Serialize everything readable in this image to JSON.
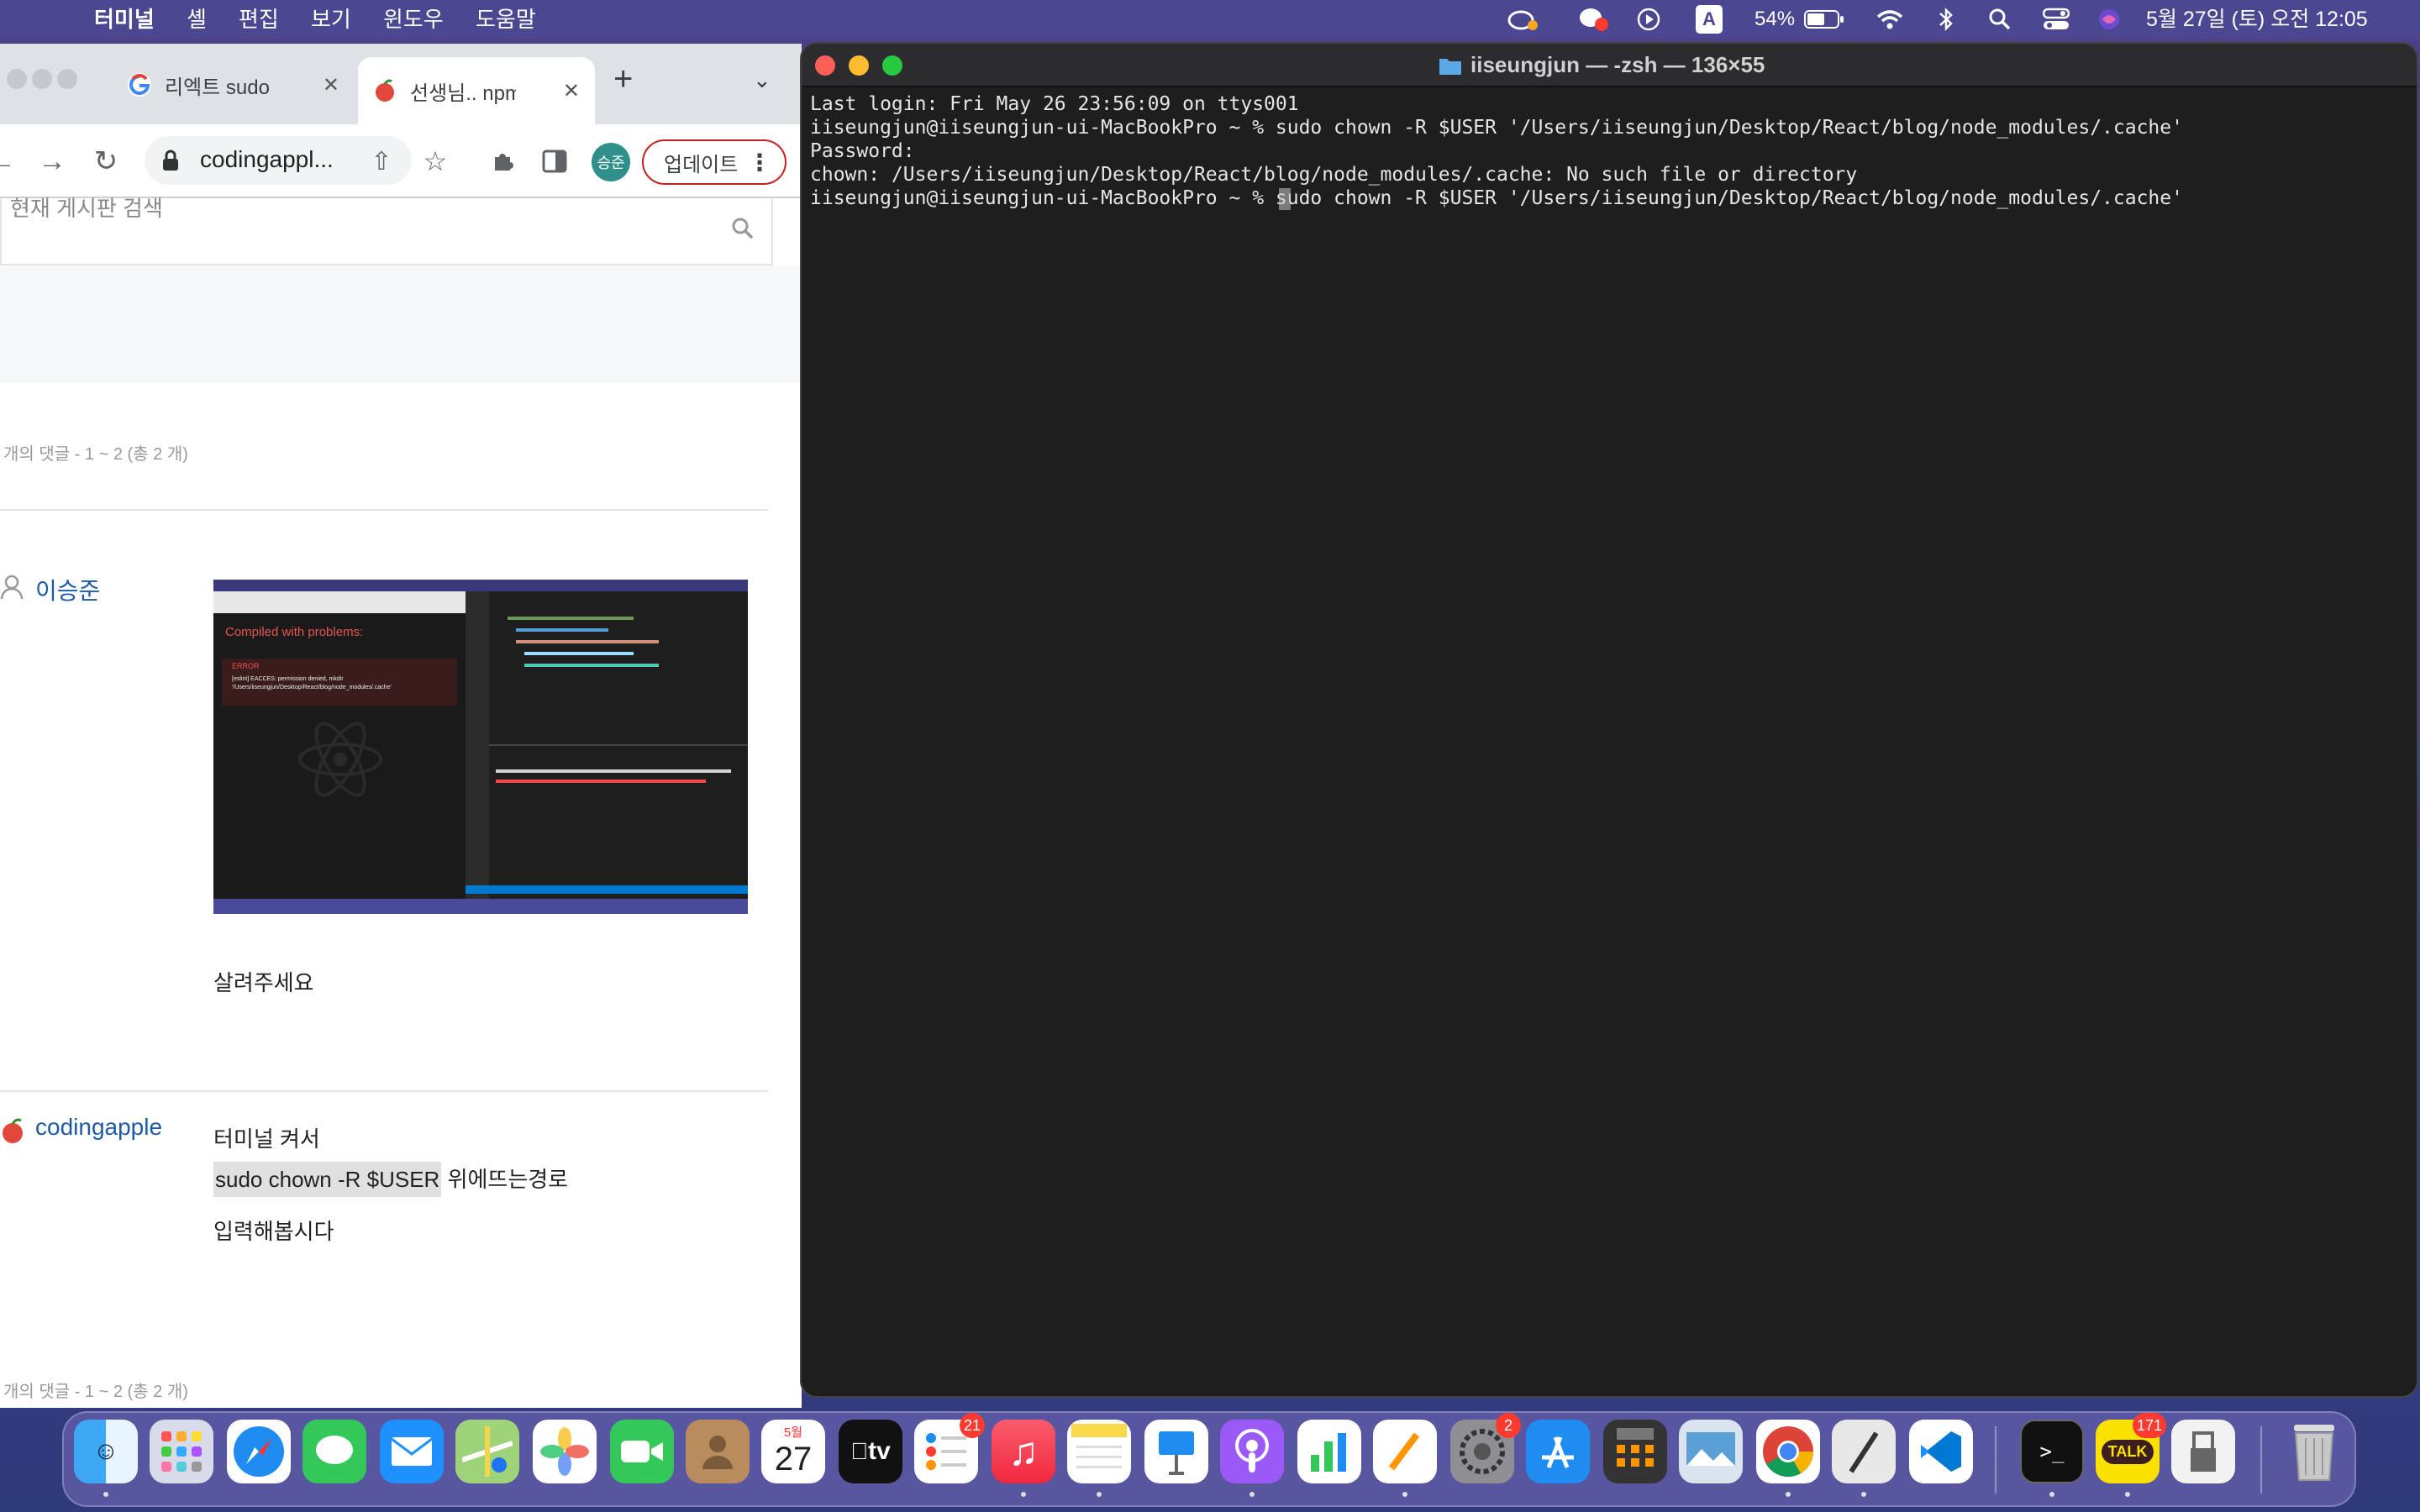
{
  "menubar": {
    "app_name": "터미널",
    "items": [
      "셸",
      "편집",
      "보기",
      "윈도우",
      "도움말"
    ],
    "battery": "54%",
    "input_indicator": "A",
    "clock": "5월 27일 (토) 오전 12:05"
  },
  "browser": {
    "tabs": [
      {
        "title": "리엑트 sudo ch"
      },
      {
        "title": "선생님.. npm s"
      }
    ],
    "address": "codingappl...",
    "profile_initial": "승준",
    "update_label": "업데이트",
    "search_placeholder": "현재 게시판 검색",
    "comment_range_top": "개의 댓글 - 1 ~ 2 (총 2 개)",
    "comment_range_bottom": "개의 댓글 - 1 ~ 2 (총 2 개)",
    "comments": [
      {
        "author": "이승준",
        "body": "살려주세요"
      },
      {
        "author": "codingapple",
        "line1": "터미널 켜서",
        "line2_code": "sudo chown -R $USER",
        "line2_rest": " 위에뜨는경로",
        "line3": "입력해봅시다"
      }
    ],
    "screenshot": {
      "error_title": "Compiled with problems:",
      "error_label": "ERROR",
      "error_text": "[eslint] EACCES: permission denied, mkdir '/Users/iiseungjun/Desktop/React/blog/node_modules/.cache'"
    }
  },
  "terminal": {
    "title": "iiseungjun — -zsh — 136×55",
    "lines": [
      "Last login: Fri May 26 23:56:09 on ttys001",
      "iiseungjun@iiseungjun-ui-MacBookPro ~ % sudo chown -R $USER '/Users/iiseungjun/Desktop/React/blog/node_modules/.cache'",
      "Password:",
      "chown: /Users/iiseungjun/Desktop/React/blog/node_modules/.cache: No such file or directory",
      "iiseungjun@iiseungjun-ui-MacBookPro ~ % sudo chown -R $USER '/Users/iiseungjun/Desktop/React/blog/node_modules/.cache'"
    ]
  },
  "dock": {
    "calendar_month": "5월",
    "calendar_day": "27",
    "tv_label": "tv",
    "badges": {
      "reminders": "21",
      "settings": "2",
      "kakao": "171"
    },
    "kakao_label": "TALK",
    "icons": [
      "finder-icon",
      "launchpad-icon",
      "safari-icon",
      "messages-icon",
      "mail-icon",
      "maps-icon",
      "photos-icon",
      "facetime-icon",
      "contacts-icon",
      "calendar-icon",
      "apple-tv-icon",
      "reminders-icon",
      "music-icon",
      "notes-icon",
      "keynote-icon",
      "podcasts-icon",
      "numbers-icon",
      "pages-icon",
      "system-settings-icon",
      "app-store-icon",
      "calculator-icon",
      "preview-icon",
      "chrome-icon",
      "script-editor-icon",
      "vscode-icon",
      "terminal-icon",
      "kakaotalk-icon",
      "usb-tool-icon",
      "trash-icon"
    ]
  }
}
